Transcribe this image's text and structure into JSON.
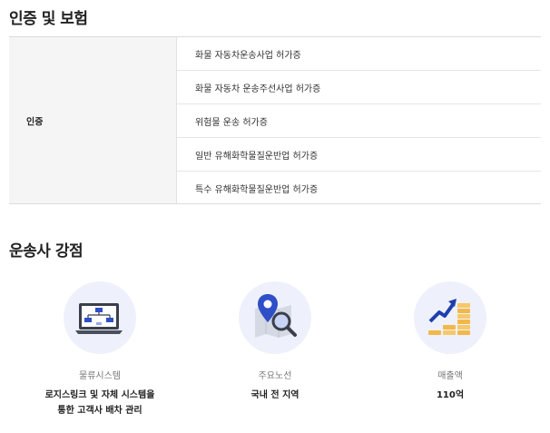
{
  "certification": {
    "title": "인증 및 보험",
    "header": "인증",
    "items": [
      "화물 자동차운송사업 허가증",
      "화물 자동차 운송주선사업 허가증",
      "위험물 운송 허가증",
      "일반 유해화학물질운반업 허가증",
      "특수 유해화학물질운반업 허가증"
    ]
  },
  "strengths": {
    "title": "운송사 강점",
    "items": [
      {
        "icon": "logistics-system-icon",
        "label": "물류시스템",
        "value": "로지스링크 및 자체 시스템을\n통한 고객사 배차 관리"
      },
      {
        "icon": "route-search-icon",
        "label": "주요노선",
        "value": "국내 전 지역"
      },
      {
        "icon": "revenue-growth-icon",
        "label": "매출액",
        "value": "110억"
      }
    ]
  },
  "colors": {
    "icon_bg": "#eef1fb",
    "accent_blue": "#2e4fc7",
    "accent_gold": "#f3b84a",
    "table_head_bg": "#f5f5f5"
  }
}
